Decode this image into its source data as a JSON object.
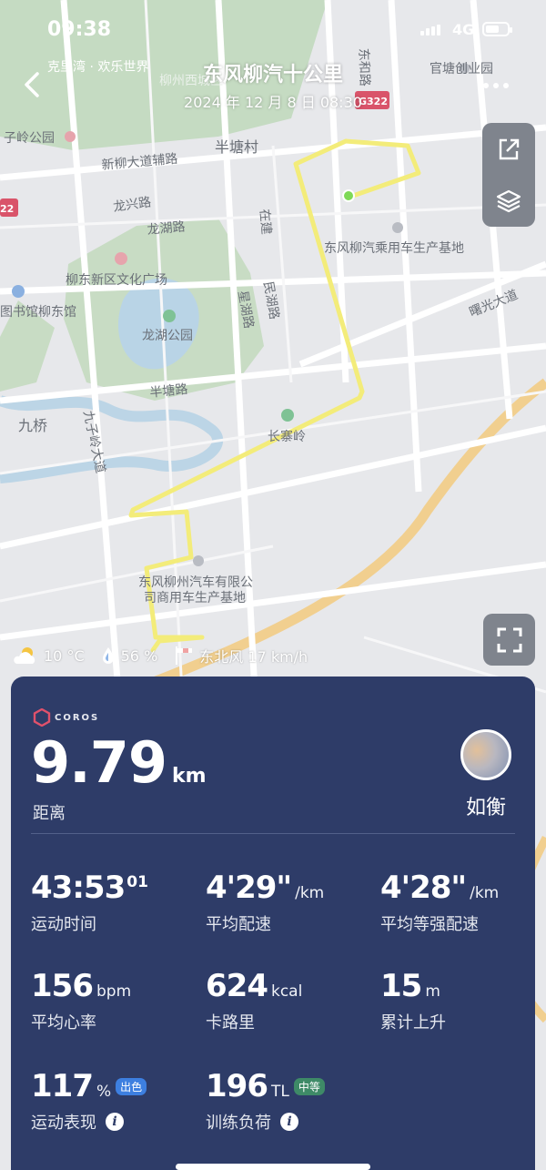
{
  "status_bar": {
    "time": "09:38",
    "network": "4G"
  },
  "header": {
    "title": "东风柳汽十公里",
    "datetime": "2024 年 12 月 8 日  08:30"
  },
  "map": {
    "labels": {
      "happy_world": "克里湾 · 欢乐世界",
      "district": "柳州西城区",
      "dongfeng_road": "东和路",
      "guantang_park": "官塘创业园",
      "ziling_park": "子岭公园",
      "road_badge": "G322",
      "road_badge_left": "22",
      "bantang_village": "半塘村",
      "xinliu_road": "新柳大道辅路",
      "longxing_road": "龙兴路",
      "longhu_road": "龙湖路",
      "zaijian": "在建",
      "factory_ne": "东风柳汽乘用车生产基地",
      "culture_square": "柳东新区文化广场",
      "library": "图书馆柳东馆",
      "minhu_road": "民湖路",
      "xinghu_road": "星湖路",
      "longhu_park": "龙湖公园",
      "shuguang_road": "曙光大道",
      "bantang_road": "半塘路",
      "jiuqiao": "九桥",
      "jiuziling_road": "九子岭大道",
      "changzhai_ling": "长寨岭",
      "dongfeng_company": "东风柳州汽车有限公",
      "dongfeng_company2": "司商用车生产基地"
    }
  },
  "weather": {
    "temp": "10 °C",
    "humidity": "56 %",
    "wind": "东北风 17 km/h"
  },
  "summary": {
    "brand": "COROS",
    "distance": {
      "value": "9.79",
      "unit": "km",
      "label": "距离"
    },
    "user": {
      "name": "如衡"
    },
    "stats": {
      "time": {
        "value": "43:53",
        "sup": "01",
        "label": "运动时间"
      },
      "avg_pace": {
        "value": "4'29\"",
        "unit": "/km",
        "label": "平均配速"
      },
      "grade_pace": {
        "value": "4'28\"",
        "unit": "/km",
        "label": "平均等强配速"
      },
      "heart_rate": {
        "value": "156",
        "unit": "bpm",
        "label": "平均心率"
      },
      "calories": {
        "value": "624",
        "unit": "kcal",
        "label": "卡路里"
      },
      "ascent": {
        "value": "15",
        "unit": "m",
        "label": "累计上升"
      },
      "performance": {
        "value": "117",
        "unit": "%",
        "badge": "出色",
        "label": "运动表现"
      },
      "training_load": {
        "value": "196",
        "unit": "TL",
        "badge": "中等",
        "label": "训练负荷"
      }
    }
  },
  "colors": {
    "card": "#2e3c68",
    "route": "#f3ec7a",
    "badge_blue": "#3d7fe0",
    "badge_green": "#3e8a67"
  }
}
